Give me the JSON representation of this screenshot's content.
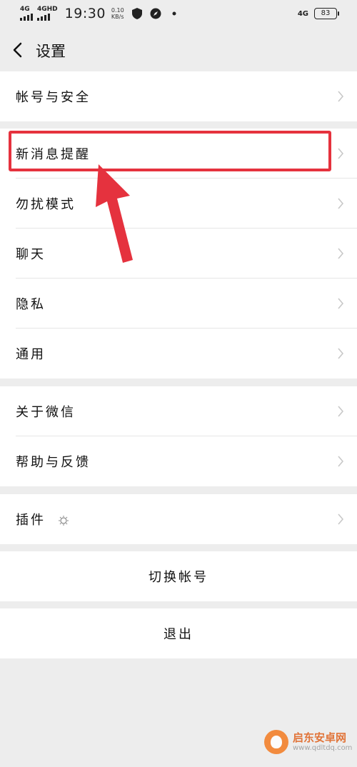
{
  "status_bar": {
    "signal1_label": "4G",
    "signal2_label": "4GHD",
    "time": "19:30",
    "speed_value": "0.10",
    "speed_unit": "KB/s",
    "network_right": "4G",
    "battery": "83"
  },
  "header": {
    "title": "设置"
  },
  "groups": [
    {
      "items": [
        "帐号与安全"
      ]
    },
    {
      "items": [
        "新消息提醒",
        "勿扰模式",
        "聊天",
        "隐私",
        "通用"
      ]
    },
    {
      "items": [
        "关于微信",
        "帮助与反馈"
      ]
    },
    {
      "items": [
        "插件"
      ]
    }
  ],
  "actions": {
    "switch_account": "切换帐号",
    "logout": "退出"
  },
  "watermark": {
    "name": "启东安卓网",
    "url": "www.qdltdq.com"
  },
  "colors": {
    "background": "#ededed",
    "card": "#ffffff",
    "highlight": "#e5323e"
  }
}
